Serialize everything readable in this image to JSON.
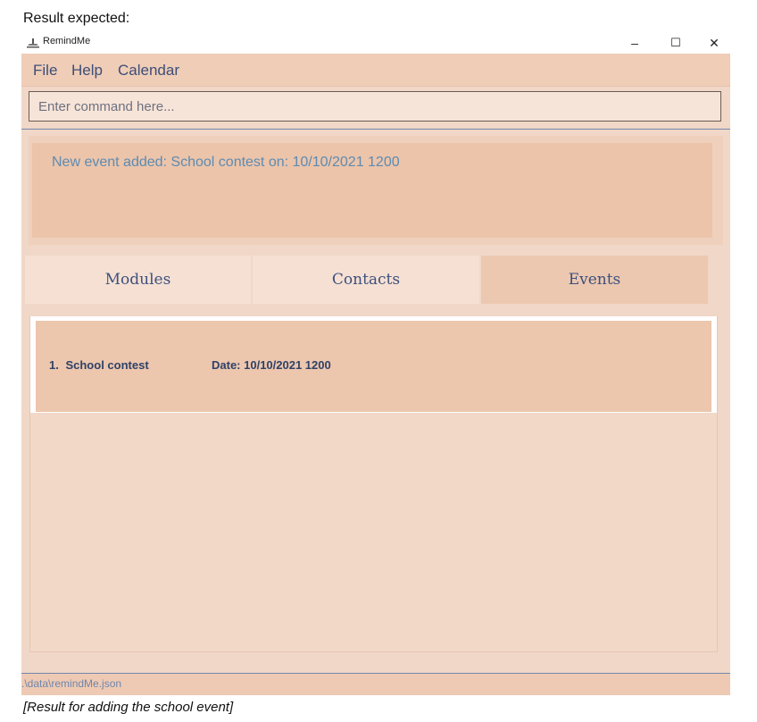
{
  "heading": "Result expected:",
  "window": {
    "title": "RemindMe",
    "app_icon": "remindme-app-icon",
    "controls": {
      "minimize": "–",
      "maximize": "☐",
      "close": "✕"
    }
  },
  "menu": {
    "items": [
      "File",
      "Help",
      "Calendar"
    ]
  },
  "command": {
    "placeholder": "Enter command here..."
  },
  "result": {
    "message": "New event added: School contest on: 10/10/2021 1200"
  },
  "tabs": [
    {
      "label": "Modules",
      "active": false
    },
    {
      "label": "Contacts",
      "active": false
    },
    {
      "label": "Events",
      "active": true
    }
  ],
  "events": [
    {
      "index": "1.",
      "name": "School contest",
      "date": "Date: 10/10/2021 1200"
    }
  ],
  "status": {
    "path": ".\\data\\remindMe.json"
  },
  "caption": "[Result for adding the school event]",
  "colors": {
    "window_bg": "#f1d7c7",
    "menu_bg": "#efcdb7",
    "active_tab": "#ecc8b0",
    "inactive_tab": "#f5e0d3",
    "text_accent": "#3e507d",
    "result_text": "#5d8bb1"
  }
}
